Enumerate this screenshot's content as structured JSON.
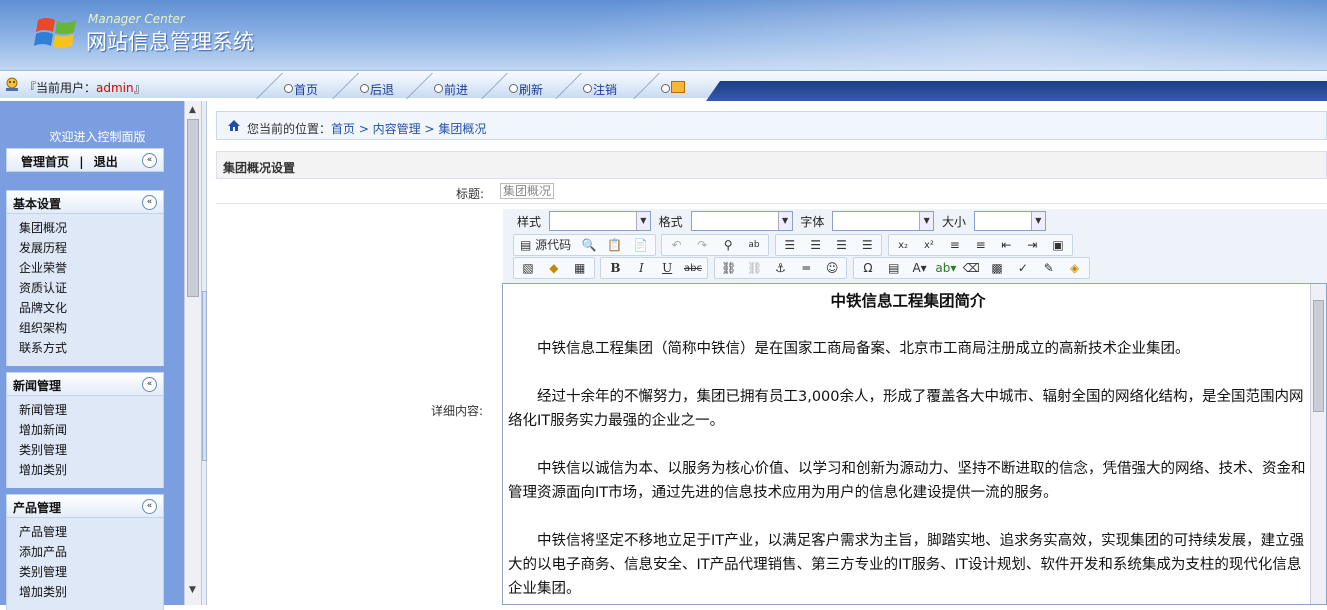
{
  "header": {
    "logo_en": "Manager Center",
    "logo_cn": "网站信息管理系统"
  },
  "navbar": {
    "user_prefix": "『当前用户：",
    "user_name": "admin",
    "user_suffix": "』",
    "items": [
      {
        "label": "首页"
      },
      {
        "label": "后退"
      },
      {
        "label": "前进"
      },
      {
        "label": "刷新"
      },
      {
        "label": "注销"
      }
    ]
  },
  "sidebar": {
    "welcome": "欢迎进入控制面版",
    "top_panel": {
      "home": "管理首页",
      "sep": "|",
      "logout": "退出"
    },
    "collapse_icon": "«",
    "panels": [
      {
        "title": "基本设置",
        "items": [
          "集团概况",
          "发展历程",
          "企业荣誉",
          "资质认证",
          "品牌文化",
          "组织架构",
          "联系方式"
        ]
      },
      {
        "title": "新闻管理",
        "items": [
          "新闻管理",
          "增加新闻",
          "类别管理",
          "增加类别"
        ]
      },
      {
        "title": "产品管理",
        "items": [
          "产品管理",
          "添加产品",
          "类别管理",
          "增加类别"
        ]
      }
    ]
  },
  "breadcrumb": {
    "label": "您当前的位置：",
    "trail": "首页 > 内容管理 > 集团概况"
  },
  "form": {
    "section_title": "集团概况设置",
    "title_label": "标题:",
    "title_value": "集团概况",
    "content_label": "详细内容:"
  },
  "editor": {
    "toolbar": {
      "style_label": "样式",
      "format_label": "格式",
      "font_label": "字体",
      "size_label": "大小",
      "source_label": "源代码",
      "bold": "B",
      "italic": "I",
      "underline": "U",
      "strike": "abc"
    },
    "document": {
      "title": "中铁信息工程集团简介",
      "paragraphs": [
        "中铁信息工程集团（简称中铁信）是在国家工商局备案、北京市工商局注册成立的高新技术企业集团。",
        "经过十余年的不懈努力，集团已拥有员工3,000余人，形成了覆盖各大中城市、辐射全国的网络化结构，是全国范围内网络化IT服务实力最强的企业之一。",
        "中铁信以诚信为本、以服务为核心价值、以学习和创新为源动力、坚持不断进取的信念，凭借强大的网络、技术、资金和管理资源面向IT市场，通过先进的信息技术应用为用户的信息化建设提供一流的服务。",
        "中铁信将坚定不移地立足于IT产业，以满足客户需求为主旨，脚踏实地、追求务实高效，实现集团的可持续发展，建立强大的以电子商务、信息安全、IT产品代理销售、第三方专业的IT服务、IT设计规划、软件开发和系统集成为支柱的现代化信息企业集团。"
      ]
    }
  }
}
